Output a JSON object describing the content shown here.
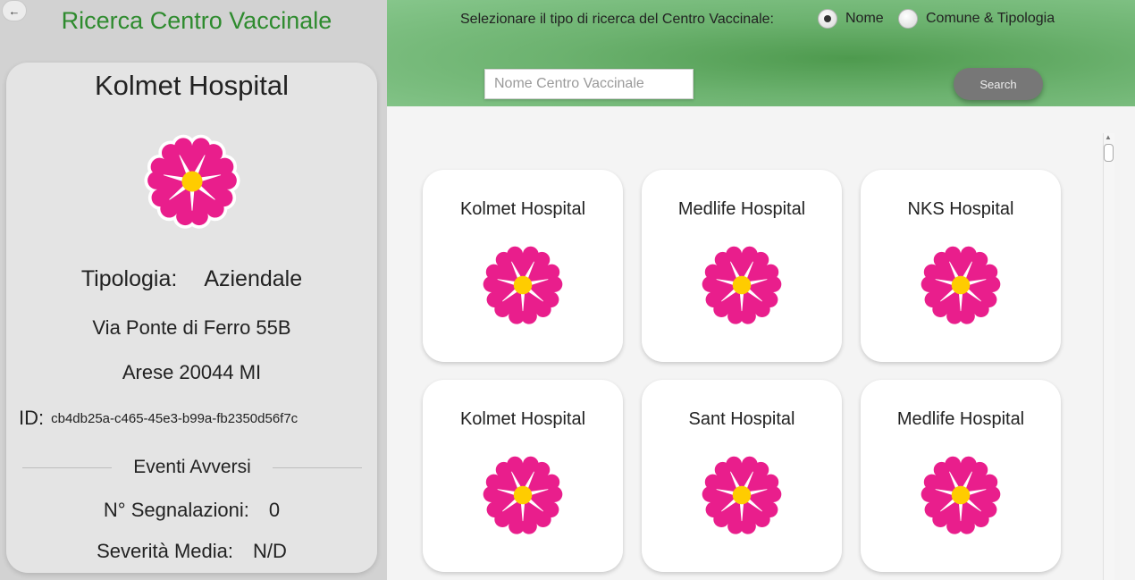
{
  "app_title": "Ricerca Centro Vaccinale",
  "back_icon": "arrow-left-icon",
  "colors": {
    "title_green": "#2e8b2e",
    "flower_pink": "#e91e8c",
    "flower_center": "#ffcc00"
  },
  "detail": {
    "name": "Kolmet Hospital",
    "tipologia_label": "Tipologia:",
    "tipologia_value": "Aziendale",
    "address_line1": "Via Ponte di Ferro 55B",
    "address_line2": "Arese 20044 MI",
    "id_label": "ID:",
    "id_value": "cb4db25a-c465-45e3-b99a-fb2350d56f7c",
    "events_title": "Eventi Avversi",
    "segnalazioni_label": "N° Segnalazioni:",
    "segnalazioni_value": "0",
    "severita_label": "Severità Media:",
    "severita_value": "N/D"
  },
  "search": {
    "type_label": "Selezionare il tipo di ricerca del Centro Vaccinale:",
    "options": [
      {
        "label": "Nome",
        "selected": true
      },
      {
        "label": "Comune & Tipologia",
        "selected": false
      }
    ],
    "placeholder": "Nome Centro Vaccinale",
    "value": "",
    "button_label": "Search"
  },
  "results": [
    {
      "name": "Kolmet Hospital"
    },
    {
      "name": "Medlife Hospital"
    },
    {
      "name": "NKS Hospital"
    },
    {
      "name": "Kolmet Hospital"
    },
    {
      "name": "Sant Hospital"
    },
    {
      "name": "Medlife Hospital"
    }
  ]
}
